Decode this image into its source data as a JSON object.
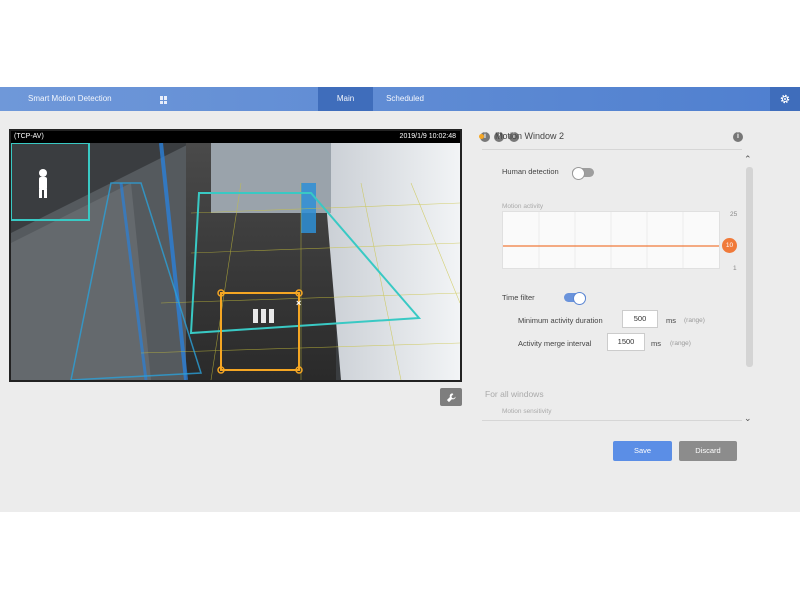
{
  "header": {
    "app_title": "Smart Motion Detection",
    "tabs": [
      {
        "label": "Main",
        "active": true
      },
      {
        "label": "Scheduled",
        "active": false
      }
    ]
  },
  "video": {
    "stream_name": "(TCP-AV)",
    "timestamp": "2019/1/9 10:02:48",
    "window_close_glyph": "×"
  },
  "panel": {
    "window_title": "Motion Window 2",
    "human_detection_label": "Human detection",
    "human_detection_on": false,
    "motion_activity_label": "Motion activity",
    "activity_chart": {
      "y_max": "25",
      "y_min": "1",
      "threshold_value": "10"
    },
    "time_filter_label": "Time filter",
    "time_filter_on": true,
    "min_duration_label": "Minimum activity duration",
    "min_duration_value": "500",
    "min_duration_unit": "ms",
    "min_duration_range": "(range)",
    "merge_interval_label": "Activity merge interval",
    "merge_interval_value": "1500",
    "merge_interval_unit": "ms",
    "merge_interval_range": "(range)",
    "for_all_windows_label": "For all windows",
    "motion_sensitivity_label": "Motion sensitivity"
  },
  "buttons": {
    "save": "Save",
    "discard": "Discard"
  },
  "colors": {
    "header": "#4f7fcf",
    "active_tab": "#3f6dbb",
    "accent_orange": "#f07a3a",
    "window_orange": "#f5a623",
    "window_cyan": "#39c9c4"
  }
}
